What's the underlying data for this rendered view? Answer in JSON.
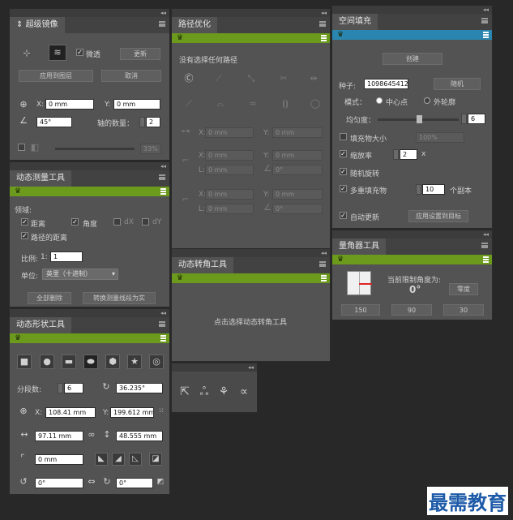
{
  "mirror": {
    "title": "超级镜像",
    "auto_label": "微透",
    "update": "更新",
    "apply": "应用到图层",
    "cancel": "取消",
    "x_label": "X:",
    "x_val": "0 mm",
    "y_label": "Y:",
    "y_val": "0 mm",
    "angle_val": "45°",
    "count_label": "轴的数量：",
    "count_val": "2",
    "slider_val": "33%"
  },
  "path": {
    "title": "路径优化",
    "status": "没有选择任何路径",
    "x_label": "X:",
    "y_label": "Y:",
    "l_label": "L:",
    "x1": "0 mm",
    "y1": "0 mm",
    "x2": "0 mm",
    "y2": "0 mm",
    "l2": "0 mm",
    "a2": "0°",
    "x3": "0 mm",
    "y3": "0 mm",
    "l3": "0 mm",
    "a3": "0°"
  },
  "fill": {
    "title": "空间填充",
    "create": "创建",
    "seed_label": "种子:",
    "seed_val": "1098645412",
    "random": "随机",
    "mode_label": "模式：",
    "mode_center": "中心点",
    "mode_outside": "外轮廓",
    "uniform_label": "均匀度：",
    "uniform_val": "6",
    "fill_size": "填充物大小",
    "fill_size_val": "100%",
    "scale_label": "缩放率",
    "scale_val": "2",
    "scale_unit": "x",
    "rand_rotate": "随机旋转",
    "multi_fill": "多重填充物",
    "multi_val": "10",
    "multi_unit": "个副本",
    "auto_update": "自动更新",
    "apply_random": "应用设置到目标"
  },
  "measure": {
    "title": "动态测量工具",
    "area_label": "领域:",
    "distance": "距离",
    "angle": "角度",
    "dx": "dX",
    "dy": "dY",
    "path_distance": "路径的距离",
    "scale_label": "比例:",
    "scale_prefix": "1:",
    "scale_val": "1",
    "unit_label": "单位:",
    "unit_val": "英里（十进制）",
    "delete_all": "全部删除",
    "convert": "转换测量线段为实"
  },
  "corner": {
    "title": "动态转角工具",
    "hint": "点击选择动态转角工具"
  },
  "angle_tool": {
    "title": "量角器工具",
    "limit_label": "当前限制角度为:",
    "limit_val": "0°",
    "zero": "零度",
    "b150": "150",
    "b90": "90",
    "b30": "30"
  },
  "shape": {
    "title": "动态形状工具",
    "seg_label": "分段数:",
    "seg_val": "6",
    "rot_val": "36.235°",
    "x_label": "X:",
    "x_val": "108.41 mm",
    "y_label": "Y:",
    "y_val": "199.612 mm",
    "w_val": "97.11 mm",
    "h_val": "48.555 mm",
    "r_val": "0 mm",
    "a1": "0°",
    "a2": "0°"
  },
  "watermark": "最需教育",
  "colors": {
    "green_band": "#6b9a1c",
    "blue_band": "#2a86b0",
    "panel": "#535353"
  }
}
